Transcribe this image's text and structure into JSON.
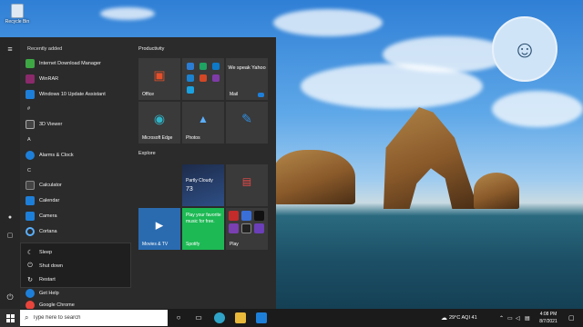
{
  "desktop": {
    "recycle_bin_label": "Recycle Bin"
  },
  "start_menu": {
    "recently_added_header": "Recently added",
    "apps": [
      {
        "label": "Internet Download Manager",
        "color": "#3ea845"
      },
      {
        "label": "WinRAR",
        "color": "#8a2a6b"
      },
      {
        "label": "Windows 10 Update Assistant",
        "color": "#1e7fd9"
      },
      {
        "label": "3D Viewer",
        "color": "#444444"
      },
      {
        "label": "Alarms & Clock",
        "color": "#1e7fd9"
      },
      {
        "label": "Calculator",
        "color": "#444444"
      },
      {
        "label": "Calendar",
        "color": "#1e7fd9"
      },
      {
        "label": "Camera",
        "color": "#1e7fd9"
      },
      {
        "label": "Cortana",
        "color": "#1e7fd9"
      },
      {
        "label": "Get Help",
        "color": "#1e7fd9"
      },
      {
        "label": "Google Chrome",
        "color": "#e8453c"
      }
    ],
    "letters": [
      "#",
      "A",
      "C"
    ],
    "power_menu": {
      "sleep": "Sleep",
      "shutdown": "Shut down",
      "restart": "Restart"
    },
    "groups": {
      "productivity": "Productivity",
      "explore": "Explore"
    },
    "tiles": {
      "office": "Office",
      "mail_text": "We speak Yahoo",
      "mail": "Mail",
      "edge": "Microsoft Edge",
      "photos": "Photos",
      "weather": "Partly Cloudy",
      "weather_temp": "73",
      "movies": "Movies & TV",
      "spotify_text": "Play your favorite music for free.",
      "spotify": "Spotify",
      "play": "Play"
    }
  },
  "taskbar": {
    "search_placeholder": "Type here to search",
    "weather": "29°C  AQI 41",
    "time": "4:08 PM",
    "date": "8/7/2021"
  }
}
